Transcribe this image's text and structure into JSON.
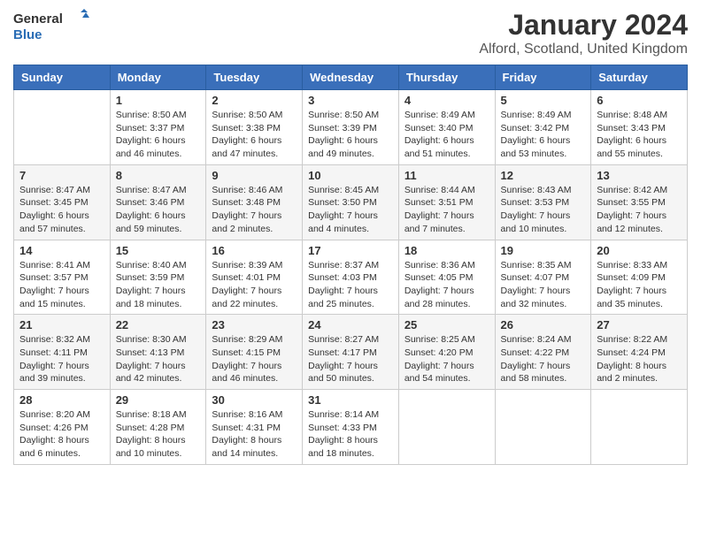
{
  "logo": {
    "general": "General",
    "blue": "Blue"
  },
  "header": {
    "month": "January 2024",
    "location": "Alford, Scotland, United Kingdom"
  },
  "weekdays": [
    "Sunday",
    "Monday",
    "Tuesday",
    "Wednesday",
    "Thursday",
    "Friday",
    "Saturday"
  ],
  "weeks": [
    [
      {
        "day": "",
        "info": ""
      },
      {
        "day": "1",
        "info": "Sunrise: 8:50 AM\nSunset: 3:37 PM\nDaylight: 6 hours and 46 minutes."
      },
      {
        "day": "2",
        "info": "Sunrise: 8:50 AM\nSunset: 3:38 PM\nDaylight: 6 hours and 47 minutes."
      },
      {
        "day": "3",
        "info": "Sunrise: 8:50 AM\nSunset: 3:39 PM\nDaylight: 6 hours and 49 minutes."
      },
      {
        "day": "4",
        "info": "Sunrise: 8:49 AM\nSunset: 3:40 PM\nDaylight: 6 hours and 51 minutes."
      },
      {
        "day": "5",
        "info": "Sunrise: 8:49 AM\nSunset: 3:42 PM\nDaylight: 6 hours and 53 minutes."
      },
      {
        "day": "6",
        "info": "Sunrise: 8:48 AM\nSunset: 3:43 PM\nDaylight: 6 hours and 55 minutes."
      }
    ],
    [
      {
        "day": "7",
        "info": "Sunrise: 8:47 AM\nSunset: 3:45 PM\nDaylight: 6 hours and 57 minutes."
      },
      {
        "day": "8",
        "info": "Sunrise: 8:47 AM\nSunset: 3:46 PM\nDaylight: 6 hours and 59 minutes."
      },
      {
        "day": "9",
        "info": "Sunrise: 8:46 AM\nSunset: 3:48 PM\nDaylight: 7 hours and 2 minutes."
      },
      {
        "day": "10",
        "info": "Sunrise: 8:45 AM\nSunset: 3:50 PM\nDaylight: 7 hours and 4 minutes."
      },
      {
        "day": "11",
        "info": "Sunrise: 8:44 AM\nSunset: 3:51 PM\nDaylight: 7 hours and 7 minutes."
      },
      {
        "day": "12",
        "info": "Sunrise: 8:43 AM\nSunset: 3:53 PM\nDaylight: 7 hours and 10 minutes."
      },
      {
        "day": "13",
        "info": "Sunrise: 8:42 AM\nSunset: 3:55 PM\nDaylight: 7 hours and 12 minutes."
      }
    ],
    [
      {
        "day": "14",
        "info": "Sunrise: 8:41 AM\nSunset: 3:57 PM\nDaylight: 7 hours and 15 minutes."
      },
      {
        "day": "15",
        "info": "Sunrise: 8:40 AM\nSunset: 3:59 PM\nDaylight: 7 hours and 18 minutes."
      },
      {
        "day": "16",
        "info": "Sunrise: 8:39 AM\nSunset: 4:01 PM\nDaylight: 7 hours and 22 minutes."
      },
      {
        "day": "17",
        "info": "Sunrise: 8:37 AM\nSunset: 4:03 PM\nDaylight: 7 hours and 25 minutes."
      },
      {
        "day": "18",
        "info": "Sunrise: 8:36 AM\nSunset: 4:05 PM\nDaylight: 7 hours and 28 minutes."
      },
      {
        "day": "19",
        "info": "Sunrise: 8:35 AM\nSunset: 4:07 PM\nDaylight: 7 hours and 32 minutes."
      },
      {
        "day": "20",
        "info": "Sunrise: 8:33 AM\nSunset: 4:09 PM\nDaylight: 7 hours and 35 minutes."
      }
    ],
    [
      {
        "day": "21",
        "info": "Sunrise: 8:32 AM\nSunset: 4:11 PM\nDaylight: 7 hours and 39 minutes."
      },
      {
        "day": "22",
        "info": "Sunrise: 8:30 AM\nSunset: 4:13 PM\nDaylight: 7 hours and 42 minutes."
      },
      {
        "day": "23",
        "info": "Sunrise: 8:29 AM\nSunset: 4:15 PM\nDaylight: 7 hours and 46 minutes."
      },
      {
        "day": "24",
        "info": "Sunrise: 8:27 AM\nSunset: 4:17 PM\nDaylight: 7 hours and 50 minutes."
      },
      {
        "day": "25",
        "info": "Sunrise: 8:25 AM\nSunset: 4:20 PM\nDaylight: 7 hours and 54 minutes."
      },
      {
        "day": "26",
        "info": "Sunrise: 8:24 AM\nSunset: 4:22 PM\nDaylight: 7 hours and 58 minutes."
      },
      {
        "day": "27",
        "info": "Sunrise: 8:22 AM\nSunset: 4:24 PM\nDaylight: 8 hours and 2 minutes."
      }
    ],
    [
      {
        "day": "28",
        "info": "Sunrise: 8:20 AM\nSunset: 4:26 PM\nDaylight: 8 hours and 6 minutes."
      },
      {
        "day": "29",
        "info": "Sunrise: 8:18 AM\nSunset: 4:28 PM\nDaylight: 8 hours and 10 minutes."
      },
      {
        "day": "30",
        "info": "Sunrise: 8:16 AM\nSunset: 4:31 PM\nDaylight: 8 hours and 14 minutes."
      },
      {
        "day": "31",
        "info": "Sunrise: 8:14 AM\nSunset: 4:33 PM\nDaylight: 8 hours and 18 minutes."
      },
      {
        "day": "",
        "info": ""
      },
      {
        "day": "",
        "info": ""
      },
      {
        "day": "",
        "info": ""
      }
    ]
  ]
}
